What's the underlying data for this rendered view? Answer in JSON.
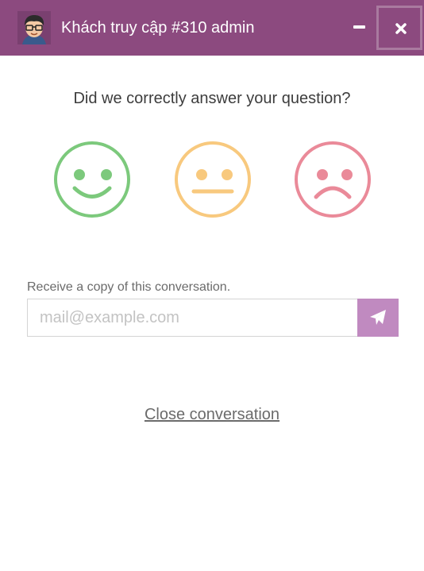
{
  "header": {
    "title": "Khách truy cập #310 admin",
    "background": "#8c4a7f",
    "avatar": "cartoon-man-with-glasses-avatar",
    "minimize_icon": "minimize-icon",
    "close_icon": "close-icon"
  },
  "feedback": {
    "question": "Did we correctly answer your question?",
    "ratings": [
      {
        "icon": "happy-face-icon",
        "color": "#7cc97c"
      },
      {
        "icon": "neutral-face-icon",
        "color": "#f8c97e"
      },
      {
        "icon": "sad-face-icon",
        "color": "#ea8a99"
      }
    ]
  },
  "transcript": {
    "label": "Receive a copy of this conversation.",
    "placeholder": "mail@example.com",
    "value": "",
    "send_icon": "paper-plane-icon",
    "send_color": "#c08ac0"
  },
  "footer": {
    "close_link": "Close conversation"
  }
}
